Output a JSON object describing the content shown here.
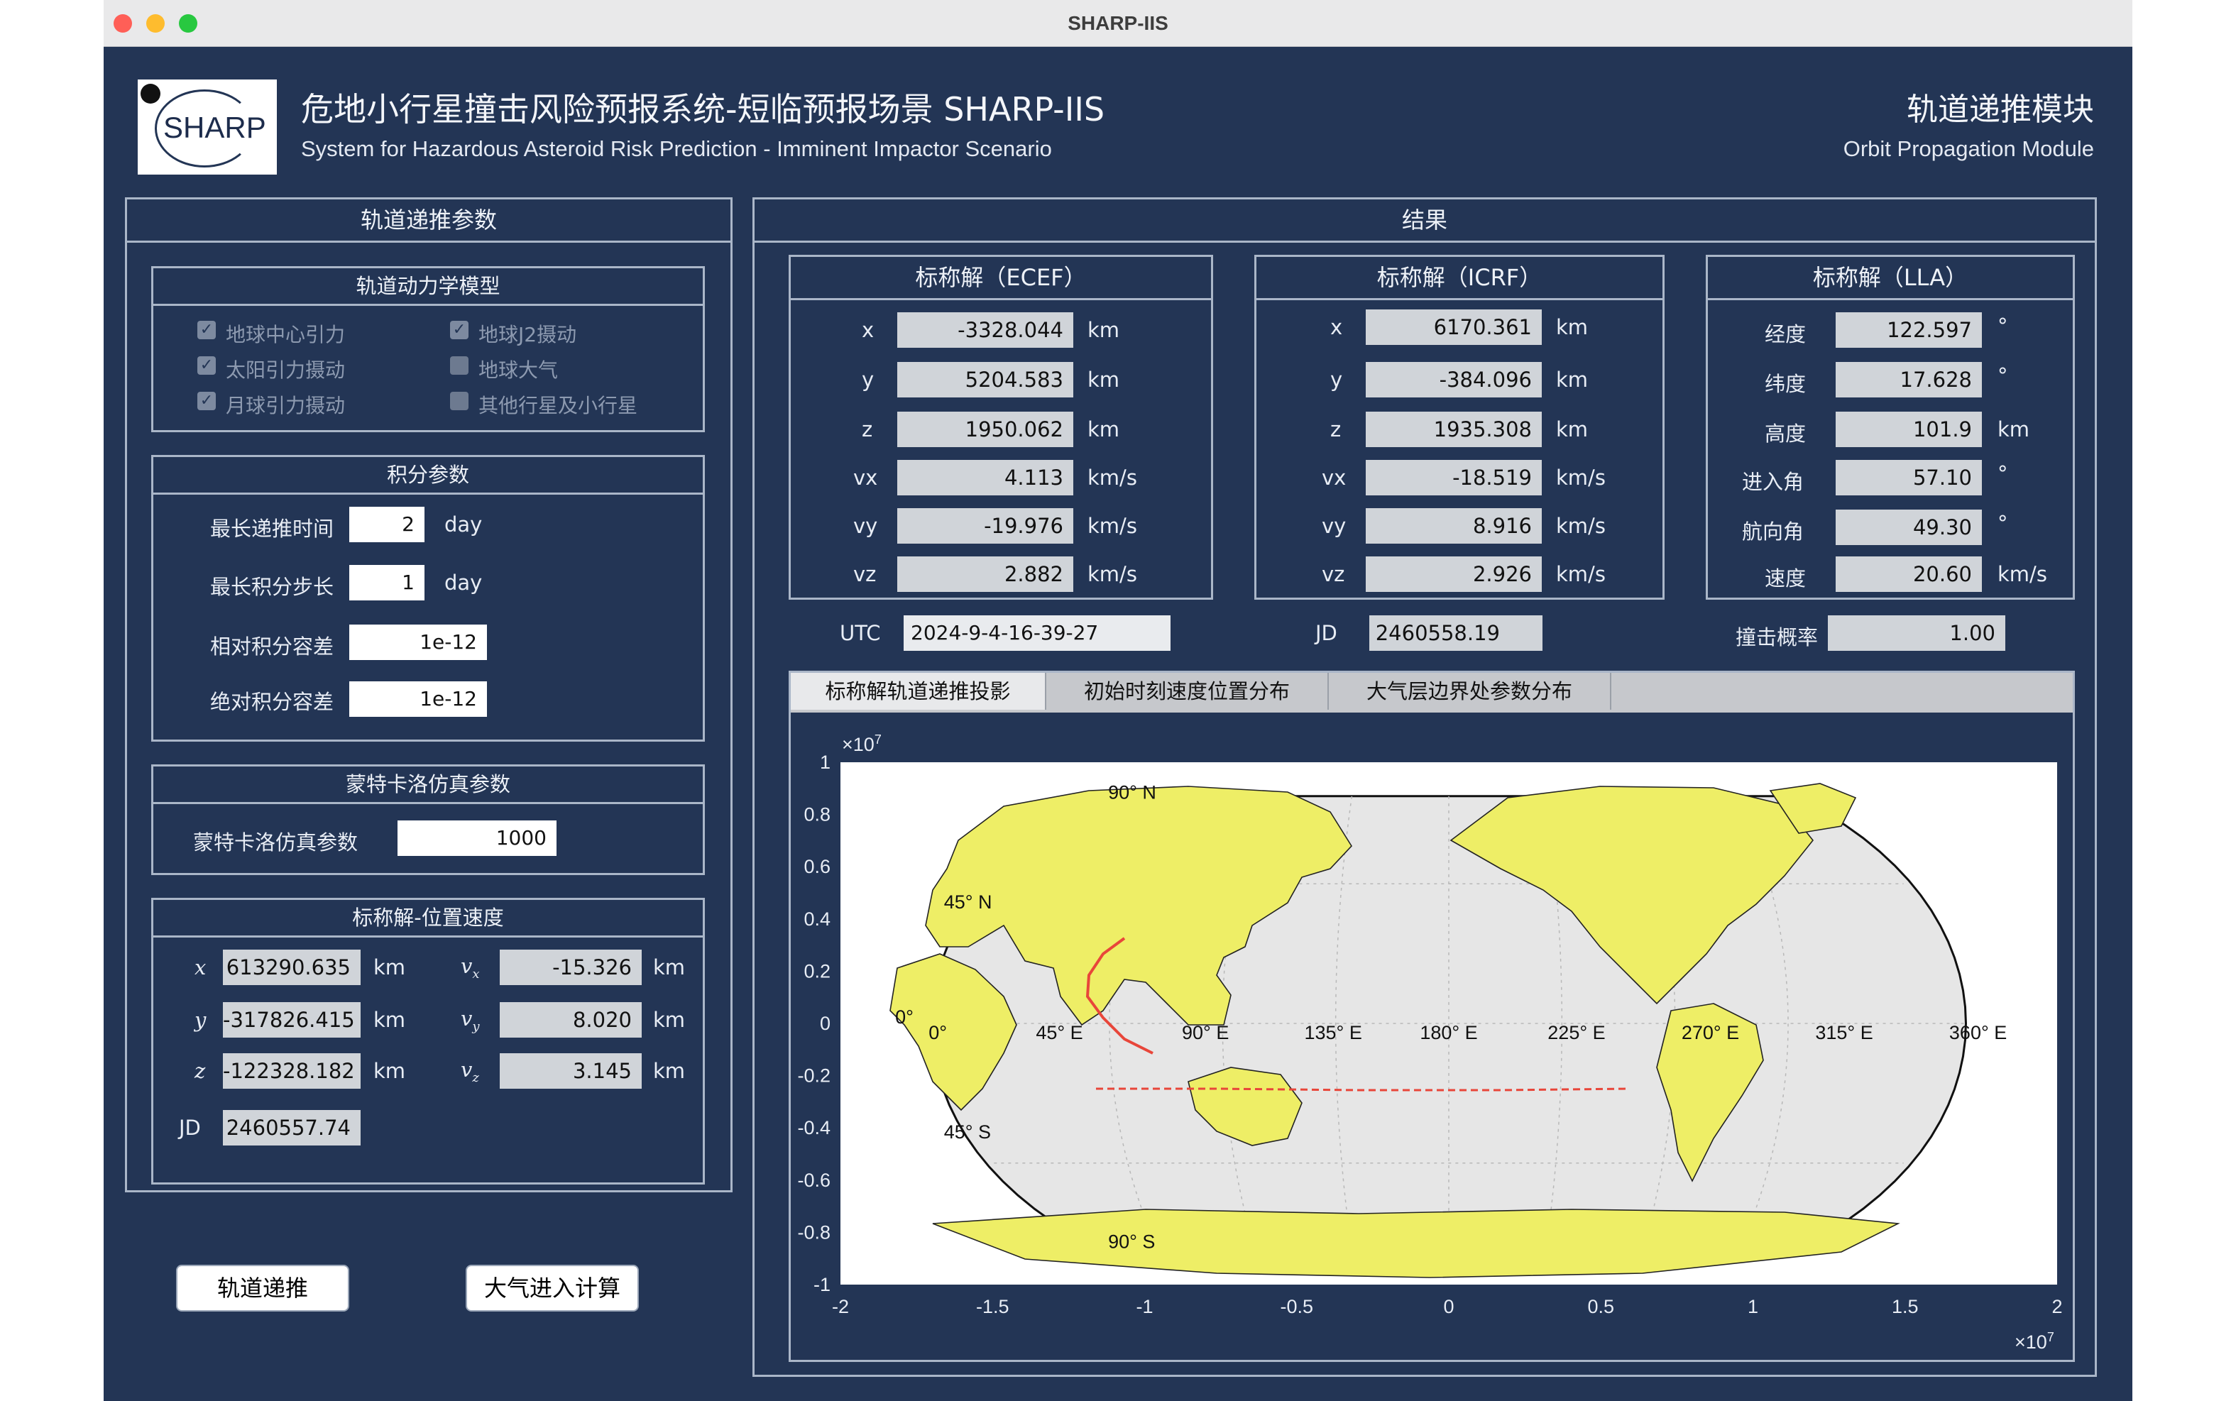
{
  "window": {
    "title": "SHARP-IIS"
  },
  "header": {
    "logo_text": "SHARP",
    "title_cn": "危地小行星撞击风险预报系统-短临预报场景 SHARP-IIS",
    "title_en": "System for Hazardous Asteroid Risk Prediction - Imminent Impactor Scenario",
    "module_cn": "轨道递推模块",
    "module_en": "Orbit Propagation Module"
  },
  "left": {
    "title": "轨道递推参数",
    "dynamics": {
      "title": "轨道动力学模型",
      "options": [
        {
          "label": "地球中心引力",
          "checked": true
        },
        {
          "label": "地球J2摄动",
          "checked": true
        },
        {
          "label": "太阳引力摄动",
          "checked": true
        },
        {
          "label": "地球大气",
          "checked": false
        },
        {
          "label": "月球引力摄动",
          "checked": true
        },
        {
          "label": "其他行星及小行星",
          "checked": false
        }
      ]
    },
    "integration": {
      "title": "积分参数",
      "max_time_label": "最长递推时间",
      "max_time": "2",
      "max_time_unit": "day",
      "max_step_label": "最长积分步长",
      "max_step": "1",
      "max_step_unit": "day",
      "rel_tol_label": "相对积分容差",
      "rel_tol": "1e-12",
      "abs_tol_label": "绝对积分容差",
      "abs_tol": "1e-12"
    },
    "montecarlo": {
      "title": "蒙特卡洛仿真参数",
      "label": "蒙特卡洛仿真参数",
      "value": "1000"
    },
    "nominal": {
      "title": "标称解-位置速度",
      "x_label": "x",
      "x": "613290.635",
      "x_unit": "km",
      "y_label": "y",
      "y": "-317826.415",
      "y_unit": "km",
      "z_label": "z",
      "z": "-122328.182",
      "z_unit": "km",
      "vx_label": "v",
      "vx_sub": "x",
      "vx": "-15.326",
      "vx_unit": "km",
      "vy_label": "v",
      "vy_sub": "y",
      "vy": "8.020",
      "vy_unit": "km",
      "vz_label": "v",
      "vz_sub": "z",
      "vz": "3.145",
      "vz_unit": "km",
      "jd_label": "JD",
      "jd": "2460557.74"
    },
    "buttons": {
      "propagate": "轨道递推",
      "atmo": "大气进入计算"
    }
  },
  "right": {
    "title": "结果",
    "ecef": {
      "title": "标称解（ECEF）",
      "rows": [
        {
          "label": "x",
          "value": "-3328.044",
          "unit": "km"
        },
        {
          "label": "y",
          "value": "5204.583",
          "unit": "km"
        },
        {
          "label": "z",
          "value": "1950.062",
          "unit": "km"
        },
        {
          "label": "vx",
          "value": "4.113",
          "unit": "km/s"
        },
        {
          "label": "vy",
          "value": "-19.976",
          "unit": "km/s"
        },
        {
          "label": "vz",
          "value": "2.882",
          "unit": "km/s"
        }
      ]
    },
    "icrf": {
      "title": "标称解（ICRF）",
      "rows": [
        {
          "label": "x",
          "value": "6170.361",
          "unit": "km"
        },
        {
          "label": "y",
          "value": "-384.096",
          "unit": "km"
        },
        {
          "label": "z",
          "value": "1935.308",
          "unit": "km"
        },
        {
          "label": "vx",
          "value": "-18.519",
          "unit": "km/s"
        },
        {
          "label": "vy",
          "value": "8.916",
          "unit": "km/s"
        },
        {
          "label": "vz",
          "value": "2.926",
          "unit": "km/s"
        }
      ]
    },
    "lla": {
      "title": "标称解（LLA）",
      "rows": [
        {
          "label": "经度",
          "value": "122.597",
          "unit": "°"
        },
        {
          "label": "纬度",
          "value": "17.628",
          "unit": "°"
        },
        {
          "label": "高度",
          "value": "101.9",
          "unit": "km"
        },
        {
          "label": "进入角",
          "value": "57.10",
          "unit": "°"
        },
        {
          "label": "航向角",
          "value": "49.30",
          "unit": "°"
        },
        {
          "label": "速度",
          "value": "20.60",
          "unit": "km/s"
        }
      ]
    },
    "utc_label": "UTC",
    "utc": "2024-9-4-16-39-27",
    "jd_label": "JD",
    "jd": "2460558.19",
    "prob_label": "撞击概率",
    "prob": "1.00",
    "tabs": [
      "标称解轨道递推投影",
      "初始时刻速度位置分布",
      "大气层边界处参数分布"
    ],
    "active_tab": 0
  },
  "chart_data": {
    "type": "line",
    "title": "",
    "xlabel": "",
    "ylabel": "",
    "x_exponent": "×10^7",
    "y_exponent": "×10^7",
    "xlim": [
      -2,
      2
    ],
    "ylim": [
      -1,
      1
    ],
    "x_ticks": [
      "-2",
      "-1.5",
      "-1",
      "-0.5",
      "0",
      "0.5",
      "1",
      "1.5",
      "2"
    ],
    "y_ticks": [
      "1",
      "0.8",
      "0.6",
      "0.4",
      "0.2",
      "0",
      "-0.2",
      "-0.4",
      "-0.6",
      "-0.8",
      "-1"
    ],
    "map_projection": "Robinson world map, centered on 180°",
    "lat_labels": [
      "90° N",
      "45° N",
      "0°",
      "45° S",
      "90° S"
    ],
    "lon_labels": [
      "0°",
      "45° E",
      "90° E",
      "135° E",
      "180° E",
      "225° E",
      "270° E",
      "315° E",
      "360° E"
    ],
    "series": [],
    "colors": {
      "land": "#eeee66",
      "ocean": "#e6e6e6",
      "track": "#e8463a",
      "track_dash": "#5b8fd0"
    }
  }
}
